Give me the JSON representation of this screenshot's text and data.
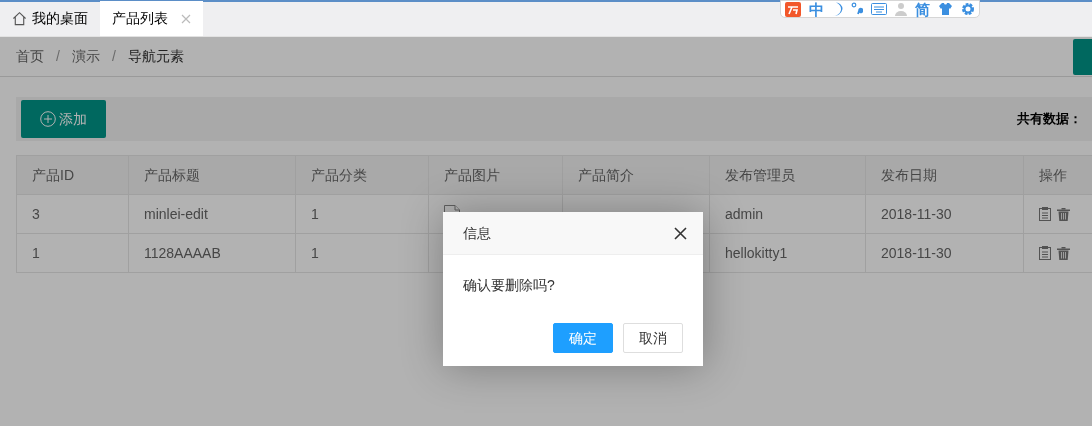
{
  "tabs": [
    {
      "label": "我的桌面",
      "kind": "home",
      "selected": false
    },
    {
      "label": "产品列表",
      "kind": "closable",
      "selected": true
    }
  ],
  "ime_toolbar": {
    "mode": "中",
    "script": "简"
  },
  "breadcrumb": [
    "首页",
    "演示",
    "导航元素"
  ],
  "breadcrumb_separator": "/",
  "toolbar": {
    "add_button": "添加",
    "total_label": "共有数据："
  },
  "table": {
    "columns": [
      "产品ID",
      "产品标题",
      "产品分类",
      "产品图片",
      "产品简介",
      "发布管理员",
      "发布日期",
      "操作"
    ],
    "rows": [
      {
        "id": "3",
        "title": "minlei-edit",
        "category": "1",
        "image": true,
        "admin": "admin",
        "date": "2018-11-30"
      },
      {
        "id": "1",
        "title": "1128AAAAB",
        "category": "1",
        "admin": "hellokitty1",
        "date": "2018-11-30"
      }
    ]
  },
  "dialog": {
    "title": "信息",
    "message": "确认要删除吗?",
    "buttons": [
      {
        "label": "确定",
        "kind": "primary"
      },
      {
        "label": "取消",
        "kind": "secondary"
      }
    ]
  }
}
